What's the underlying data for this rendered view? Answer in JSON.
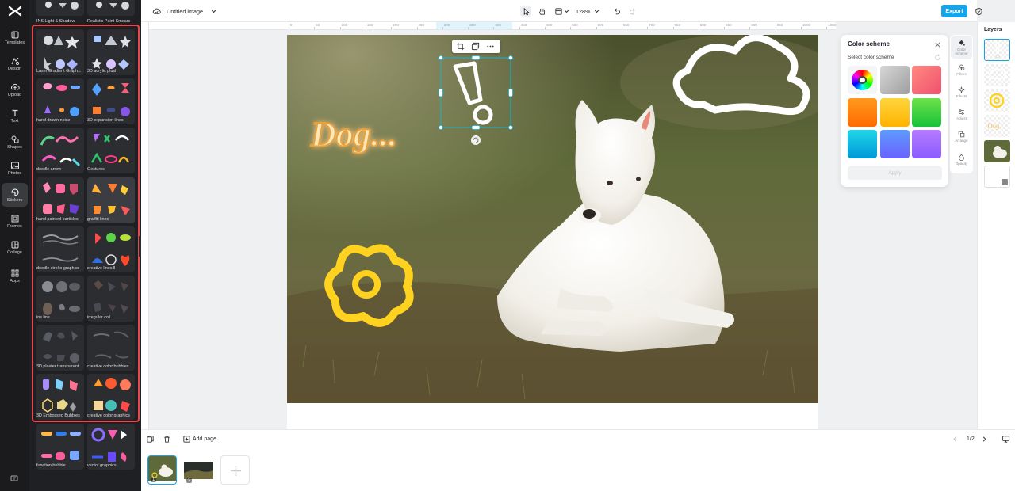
{
  "nav": {
    "items": [
      {
        "label": "Templates",
        "icon": "templates-icon"
      },
      {
        "label": "Design",
        "icon": "design-icon"
      },
      {
        "label": "Upload",
        "icon": "upload-icon"
      },
      {
        "label": "Text",
        "icon": "text-icon"
      },
      {
        "label": "Shapes",
        "icon": "shapes-icon"
      },
      {
        "label": "Photos",
        "icon": "photos-icon"
      },
      {
        "label": "Stickers",
        "icon": "stickers-icon"
      },
      {
        "label": "Frames",
        "icon": "frames-icon"
      },
      {
        "label": "Collage",
        "icon": "collage-icon"
      },
      {
        "label": "Apps",
        "icon": "apps-icon"
      }
    ],
    "active": "Stickers"
  },
  "stickers": {
    "top_labels": [
      "INS Light & Shadow",
      "Realistic Paint Smears"
    ],
    "categories": [
      "Laser Gradient Graph...",
      "3D acrylic plush",
      "hand drawn noise",
      "3D expansion lines",
      "doodle arrow",
      "Gestures",
      "hand painted particles",
      "graffiti lines",
      "doodle stroke graphics",
      "creative linesⅢ",
      "ins line",
      "irregular coil",
      "3D plaster transparent",
      "creative color bubbles",
      "3D Embossed Bubbles",
      "creative color graphics",
      "function bubble",
      "vector graphics"
    ]
  },
  "topbar": {
    "title": "Untitled image",
    "zoom": "128%",
    "export_label": "Export"
  },
  "ruler": {
    "marks": [
      "0",
      "50",
      "100",
      "150",
      "200",
      "250",
      "300",
      "350",
      "400",
      "450",
      "500",
      "550",
      "600",
      "650",
      "700",
      "750",
      "800",
      "850",
      "900",
      "950",
      "1000",
      "1050",
      "1100"
    ]
  },
  "canvas": {
    "text_sticker": "Dog...",
    "colors": {
      "accent": "#16a5e8",
      "sticker_yellow": "#ffd21f",
      "highlight_red": "#e8474d"
    }
  },
  "color_panel": {
    "title": "Color scheme",
    "subtitle": "Select color scheme",
    "apply_label": "Apply",
    "swatches": [
      {
        "name": "color-wheel",
        "css": "conic-gradient(red,yellow,lime,cyan,blue,magenta,red)"
      },
      {
        "name": "gray",
        "css": "linear-gradient(135deg,#d7d7d7,#9e9e9e)"
      },
      {
        "name": "coral",
        "css": "linear-gradient(135deg,#ff8a80,#f0506e)"
      },
      {
        "name": "orange",
        "css": "linear-gradient(180deg,#ff9a1e,#ff6a00)"
      },
      {
        "name": "yellow",
        "css": "linear-gradient(180deg,#ffd53d,#ffb300)"
      },
      {
        "name": "green",
        "css": "linear-gradient(180deg,#6ee24a,#16c23a)"
      },
      {
        "name": "cyan",
        "css": "linear-gradient(180deg,#20d6e8,#0098d8)"
      },
      {
        "name": "blue",
        "css": "linear-gradient(180deg,#5d9bff,#6a62ff)"
      },
      {
        "name": "violet",
        "css": "linear-gradient(180deg,#b57bff,#8a5cff)"
      }
    ]
  },
  "prop_tabs": [
    {
      "label": "Color scheme",
      "icon": "paint-bucket-icon"
    },
    {
      "label": "Filters",
      "icon": "filters-icon"
    },
    {
      "label": "Effects",
      "icon": "effects-icon"
    },
    {
      "label": "Adjust",
      "icon": "adjust-icon"
    },
    {
      "label": "Arrange",
      "icon": "arrange-icon"
    },
    {
      "label": "Opacity",
      "icon": "opacity-icon"
    }
  ],
  "layers": {
    "title": "Layers"
  },
  "bottom": {
    "add_page_label": "Add page",
    "page_counter": "1/2",
    "page_numbers": [
      "1",
      "2"
    ]
  }
}
